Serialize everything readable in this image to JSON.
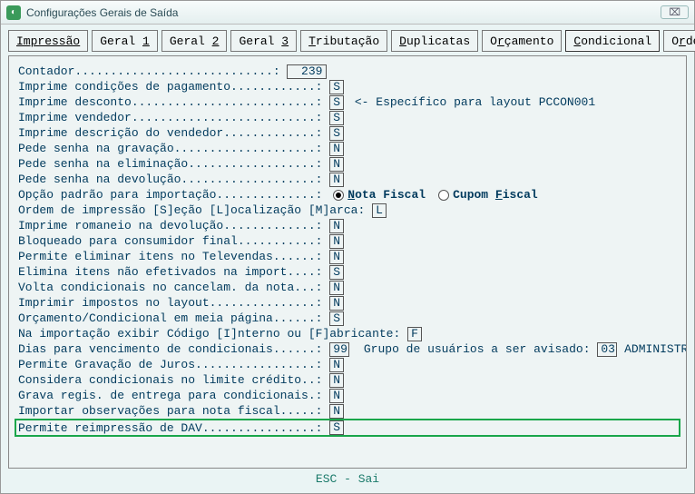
{
  "window": {
    "title": "Configurações Gerais de Saída",
    "close_glyph": "⌧"
  },
  "tabs": {
    "t0": "Impressão",
    "t1_pre": "Geral ",
    "t1_u": "1",
    "t2_pre": "Geral ",
    "t2_u": "2",
    "t3_pre": "Geral ",
    "t3_u": "3",
    "t4_u": "T",
    "t4_post": "ributação",
    "t5_u": "D",
    "t5_post": "uplicatas",
    "t6_pre": "O",
    "t6_u": "r",
    "t6_post": "çamento",
    "t7_u": "C",
    "t7_post": "ondicional",
    "t8_pre": "O",
    "t8_u": "r",
    "t8_post": "dem Cred."
  },
  "rows": {
    "contador_lbl": "Contador............................: ",
    "contador_val": "239",
    "imprime_cond_lbl": "Imprime condições de pagamento............: ",
    "imprime_cond_val": "S",
    "imprime_desc_lbl": "Imprime desconto..........................: ",
    "imprime_desc_val": "S",
    "imprime_desc_note": " <- Específico para layout PCCON001",
    "imprime_vend_lbl": "Imprime vendedor..........................: ",
    "imprime_vend_val": "S",
    "imprime_desc_vend_lbl": "Imprime descrição do vendedor.............: ",
    "imprime_desc_vend_val": "S",
    "pede_senha_grav_lbl": "Pede senha na gravação....................: ",
    "pede_senha_grav_val": "N",
    "pede_senha_elim_lbl": "Pede senha na eliminação..................: ",
    "pede_senha_elim_val": "N",
    "pede_senha_dev_lbl": "Pede senha na devolução...................: ",
    "pede_senha_dev_val": "N",
    "opcao_padrao_lbl": "Opção padrão para importação..............: ",
    "radio_nota_u": "N",
    "radio_nota_post": "ota Fiscal",
    "radio_cupom_pre": "Cupom ",
    "radio_cupom_u": "F",
    "radio_cupom_post": "iscal",
    "ordem_imp_lbl": "Ordem de impressão [S]eção [L]ocalização [M]arca: ",
    "ordem_imp_val": "L",
    "imprime_rom_lbl": "Imprime romaneio na devolução.............: ",
    "imprime_rom_val": "N",
    "bloq_cons_lbl": "Bloqueado para consumidor final...........: ",
    "bloq_cons_val": "N",
    "perm_elim_tv_lbl": "Permite eliminar itens no Televendas......: ",
    "perm_elim_tv_val": "N",
    "elim_itens_lbl": "Elimina itens não efetivados na import....: ",
    "elim_itens_val": "S",
    "volta_cond_lbl": "Volta condicionais no cancelam. da nota...: ",
    "volta_cond_val": "N",
    "impr_impostos_lbl": "Imprimir impostos no layout...............: ",
    "impr_impostos_val": "N",
    "orc_meia_lbl": "Orçamento/Condicional em meia página......: ",
    "orc_meia_val": "S",
    "na_import_lbl": "Na importação exibir Código [I]nterno ou [F]abricante: ",
    "na_import_val": "F",
    "dias_venc_lbl": "Dias para vencimento de condicionais......: ",
    "dias_venc_val": "99",
    "grupo_usu_lbl": "  Grupo de usuários a ser avisado: ",
    "grupo_usu_val": "03",
    "grupo_usu_name": " ADMINISTRA",
    "perm_grav_juros_lbl": "Permite Gravação de Juros.................: ",
    "perm_grav_juros_val": "N",
    "cons_cond_lbl": "Considera condicionais no limite crédito..: ",
    "cons_cond_val": "N",
    "grava_regis_lbl": "Grava regis. de entrega para condicionais.: ",
    "grava_regis_val": "N",
    "import_obs_lbl": "Importar observações para nota fiscal.....: ",
    "import_obs_val": "N",
    "perm_reimp_lbl": "Permite reimpressão de DAV................: ",
    "perm_reimp_val": "S"
  },
  "footer": "ESC - Sai"
}
